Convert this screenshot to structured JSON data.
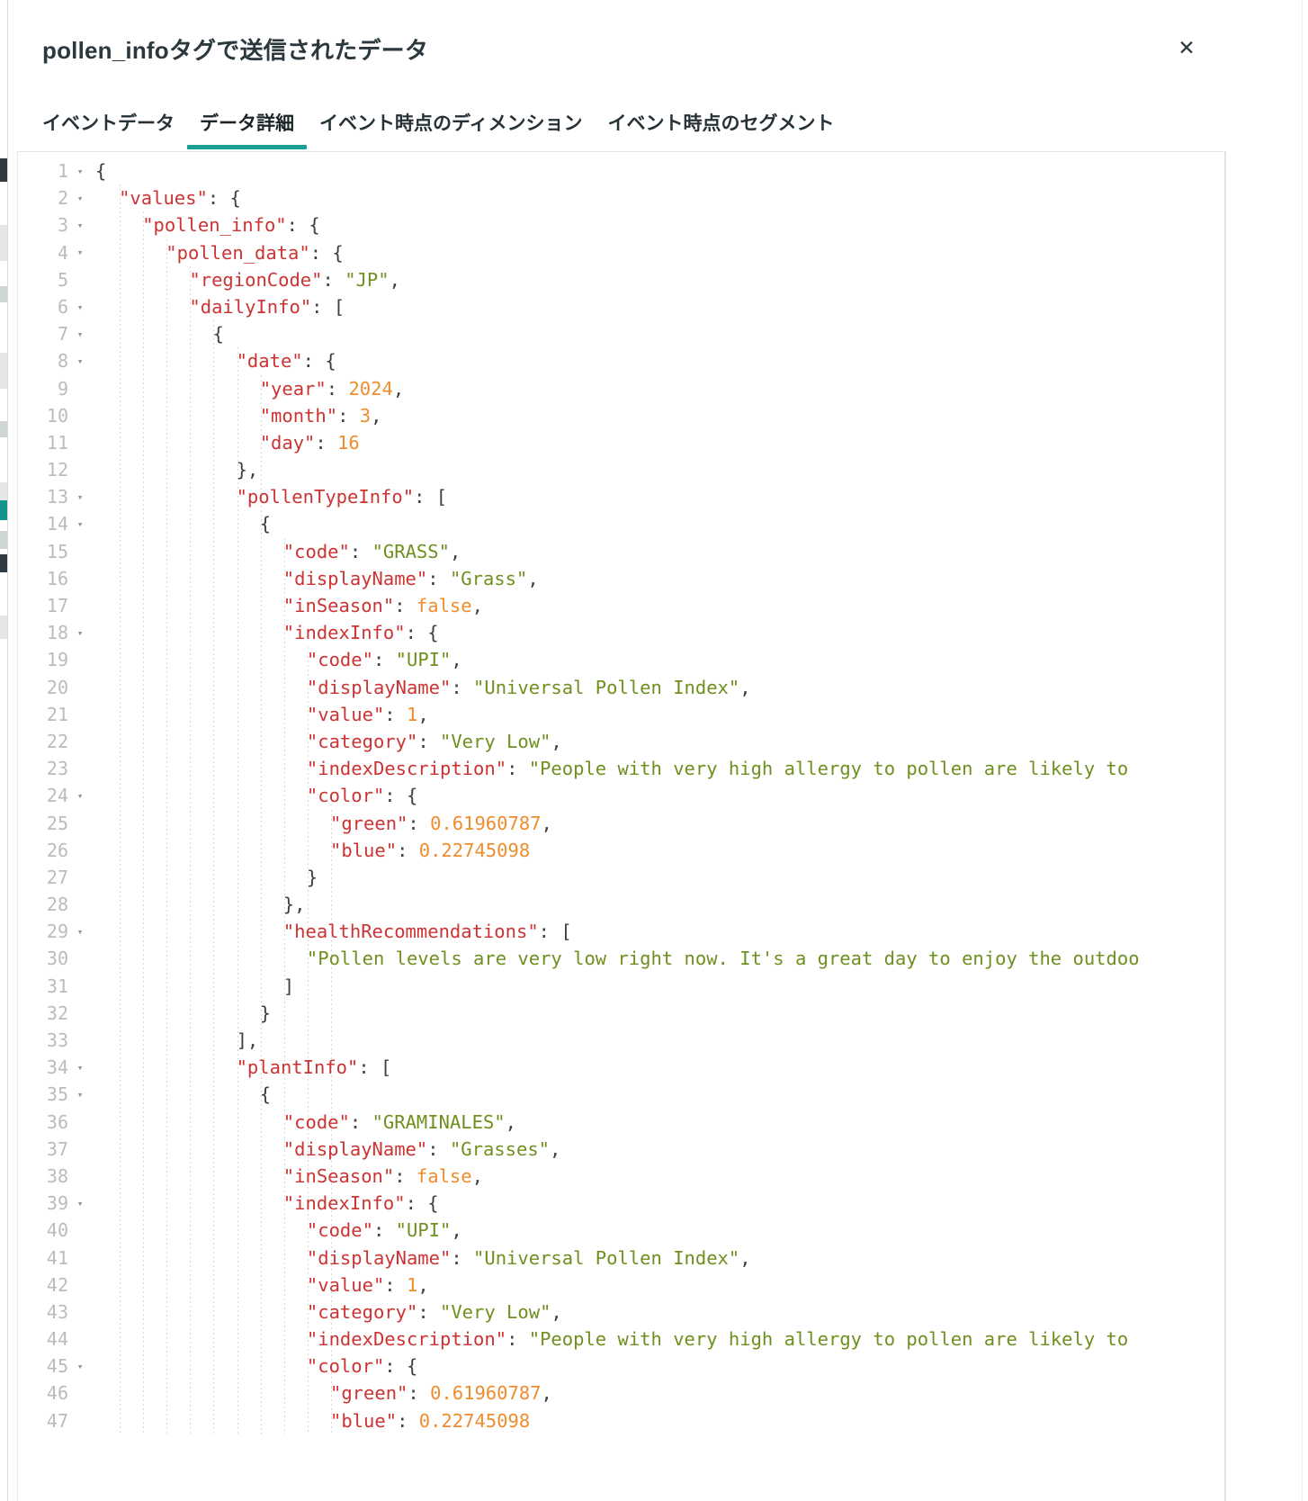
{
  "window": {
    "title": "pollen_infoタグで送信されたデータ",
    "close_label": "✕",
    "accent_color": "#1a9e96"
  },
  "tabs": [
    {
      "label": "イベントデータ",
      "active": false
    },
    {
      "label": "データ詳細",
      "active": true
    },
    {
      "label": "イベント時点のディメンション",
      "active": false
    },
    {
      "label": "イベント時点のセグメント",
      "active": false
    }
  ],
  "editor": {
    "syntax_colors": {
      "key": "#cc3333",
      "string": "#6f8f1e",
      "number": "#ef8c2e",
      "punctuation": "#3b4043",
      "line_number": "#b9bcbe"
    },
    "lines": [
      {
        "n": "1",
        "fold": "▾",
        "indent": 0,
        "tokens": [
          {
            "t": "p",
            "v": "{"
          }
        ]
      },
      {
        "n": "2",
        "fold": "▾",
        "indent": 1,
        "tokens": [
          {
            "t": "k",
            "v": "\"values\""
          },
          {
            "t": "p",
            "v": ": {"
          }
        ]
      },
      {
        "n": "3",
        "fold": "▾",
        "indent": 2,
        "tokens": [
          {
            "t": "k",
            "v": "\"pollen_info\""
          },
          {
            "t": "p",
            "v": ": {"
          }
        ]
      },
      {
        "n": "4",
        "fold": "▾",
        "indent": 3,
        "tokens": [
          {
            "t": "k",
            "v": "\"pollen_data\""
          },
          {
            "t": "p",
            "v": ": {"
          }
        ]
      },
      {
        "n": "5",
        "fold": "",
        "indent": 4,
        "tokens": [
          {
            "t": "k",
            "v": "\"regionCode\""
          },
          {
            "t": "p",
            "v": ": "
          },
          {
            "t": "s",
            "v": "\"JP\""
          },
          {
            "t": "p",
            "v": ","
          }
        ]
      },
      {
        "n": "6",
        "fold": "▾",
        "indent": 4,
        "tokens": [
          {
            "t": "k",
            "v": "\"dailyInfo\""
          },
          {
            "t": "p",
            "v": ": ["
          }
        ]
      },
      {
        "n": "7",
        "fold": "▾",
        "indent": 5,
        "tokens": [
          {
            "t": "p",
            "v": "{"
          }
        ]
      },
      {
        "n": "8",
        "fold": "▾",
        "indent": 6,
        "tokens": [
          {
            "t": "k",
            "v": "\"date\""
          },
          {
            "t": "p",
            "v": ": {"
          }
        ]
      },
      {
        "n": "9",
        "fold": "",
        "indent": 7,
        "tokens": [
          {
            "t": "k",
            "v": "\"year\""
          },
          {
            "t": "p",
            "v": ": "
          },
          {
            "t": "n",
            "v": "2024"
          },
          {
            "t": "p",
            "v": ","
          }
        ]
      },
      {
        "n": "10",
        "fold": "",
        "indent": 7,
        "tokens": [
          {
            "t": "k",
            "v": "\"month\""
          },
          {
            "t": "p",
            "v": ": "
          },
          {
            "t": "n",
            "v": "3"
          },
          {
            "t": "p",
            "v": ","
          }
        ]
      },
      {
        "n": "11",
        "fold": "",
        "indent": 7,
        "tokens": [
          {
            "t": "k",
            "v": "\"day\""
          },
          {
            "t": "p",
            "v": ": "
          },
          {
            "t": "n",
            "v": "16"
          }
        ]
      },
      {
        "n": "12",
        "fold": "",
        "indent": 6,
        "tokens": [
          {
            "t": "p",
            "v": "},"
          }
        ]
      },
      {
        "n": "13",
        "fold": "▾",
        "indent": 6,
        "tokens": [
          {
            "t": "k",
            "v": "\"pollenTypeInfo\""
          },
          {
            "t": "p",
            "v": ": ["
          }
        ]
      },
      {
        "n": "14",
        "fold": "▾",
        "indent": 7,
        "tokens": [
          {
            "t": "p",
            "v": "{"
          }
        ]
      },
      {
        "n": "15",
        "fold": "",
        "indent": 8,
        "tokens": [
          {
            "t": "k",
            "v": "\"code\""
          },
          {
            "t": "p",
            "v": ": "
          },
          {
            "t": "s",
            "v": "\"GRASS\""
          },
          {
            "t": "p",
            "v": ","
          }
        ]
      },
      {
        "n": "16",
        "fold": "",
        "indent": 8,
        "tokens": [
          {
            "t": "k",
            "v": "\"displayName\""
          },
          {
            "t": "p",
            "v": ": "
          },
          {
            "t": "s",
            "v": "\"Grass\""
          },
          {
            "t": "p",
            "v": ","
          }
        ]
      },
      {
        "n": "17",
        "fold": "",
        "indent": 8,
        "tokens": [
          {
            "t": "k",
            "v": "\"inSeason\""
          },
          {
            "t": "p",
            "v": ": "
          },
          {
            "t": "n",
            "v": "false"
          },
          {
            "t": "p",
            "v": ","
          }
        ]
      },
      {
        "n": "18",
        "fold": "▾",
        "indent": 8,
        "tokens": [
          {
            "t": "k",
            "v": "\"indexInfo\""
          },
          {
            "t": "p",
            "v": ": {"
          }
        ]
      },
      {
        "n": "19",
        "fold": "",
        "indent": 9,
        "tokens": [
          {
            "t": "k",
            "v": "\"code\""
          },
          {
            "t": "p",
            "v": ": "
          },
          {
            "t": "s",
            "v": "\"UPI\""
          },
          {
            "t": "p",
            "v": ","
          }
        ]
      },
      {
        "n": "20",
        "fold": "",
        "indent": 9,
        "tokens": [
          {
            "t": "k",
            "v": "\"displayName\""
          },
          {
            "t": "p",
            "v": ": "
          },
          {
            "t": "s",
            "v": "\"Universal Pollen Index\""
          },
          {
            "t": "p",
            "v": ","
          }
        ]
      },
      {
        "n": "21",
        "fold": "",
        "indent": 9,
        "tokens": [
          {
            "t": "k",
            "v": "\"value\""
          },
          {
            "t": "p",
            "v": ": "
          },
          {
            "t": "n",
            "v": "1"
          },
          {
            "t": "p",
            "v": ","
          }
        ]
      },
      {
        "n": "22",
        "fold": "",
        "indent": 9,
        "tokens": [
          {
            "t": "k",
            "v": "\"category\""
          },
          {
            "t": "p",
            "v": ": "
          },
          {
            "t": "s",
            "v": "\"Very Low\""
          },
          {
            "t": "p",
            "v": ","
          }
        ]
      },
      {
        "n": "23",
        "fold": "",
        "indent": 9,
        "tokens": [
          {
            "t": "k",
            "v": "\"indexDescription\""
          },
          {
            "t": "p",
            "v": ": "
          },
          {
            "t": "s",
            "v": "\"People with very high allergy to pollen are likely to"
          }
        ]
      },
      {
        "n": "24",
        "fold": "▾",
        "indent": 9,
        "tokens": [
          {
            "t": "k",
            "v": "\"color\""
          },
          {
            "t": "p",
            "v": ": {"
          }
        ]
      },
      {
        "n": "25",
        "fold": "",
        "indent": 10,
        "tokens": [
          {
            "t": "k",
            "v": "\"green\""
          },
          {
            "t": "p",
            "v": ": "
          },
          {
            "t": "n",
            "v": "0.61960787"
          },
          {
            "t": "p",
            "v": ","
          }
        ]
      },
      {
        "n": "26",
        "fold": "",
        "indent": 10,
        "tokens": [
          {
            "t": "k",
            "v": "\"blue\""
          },
          {
            "t": "p",
            "v": ": "
          },
          {
            "t": "n",
            "v": "0.22745098"
          }
        ]
      },
      {
        "n": "27",
        "fold": "",
        "indent": 9,
        "tokens": [
          {
            "t": "p",
            "v": "}"
          }
        ]
      },
      {
        "n": "28",
        "fold": "",
        "indent": 8,
        "tokens": [
          {
            "t": "p",
            "v": "},"
          }
        ]
      },
      {
        "n": "29",
        "fold": "▾",
        "indent": 8,
        "tokens": [
          {
            "t": "k",
            "v": "\"healthRecommendations\""
          },
          {
            "t": "p",
            "v": ": ["
          }
        ]
      },
      {
        "n": "30",
        "fold": "",
        "indent": 9,
        "tokens": [
          {
            "t": "s",
            "v": "\"Pollen levels are very low right now. It's a great day to enjoy the outdoo"
          }
        ]
      },
      {
        "n": "31",
        "fold": "",
        "indent": 8,
        "tokens": [
          {
            "t": "p",
            "v": "]"
          }
        ]
      },
      {
        "n": "32",
        "fold": "",
        "indent": 7,
        "tokens": [
          {
            "t": "p",
            "v": "}"
          }
        ]
      },
      {
        "n": "33",
        "fold": "",
        "indent": 6,
        "tokens": [
          {
            "t": "p",
            "v": "],"
          }
        ]
      },
      {
        "n": "34",
        "fold": "▾",
        "indent": 6,
        "tokens": [
          {
            "t": "k",
            "v": "\"plantInfo\""
          },
          {
            "t": "p",
            "v": ": ["
          }
        ]
      },
      {
        "n": "35",
        "fold": "▾",
        "indent": 7,
        "tokens": [
          {
            "t": "p",
            "v": "{"
          }
        ]
      },
      {
        "n": "36",
        "fold": "",
        "indent": 8,
        "tokens": [
          {
            "t": "k",
            "v": "\"code\""
          },
          {
            "t": "p",
            "v": ": "
          },
          {
            "t": "s",
            "v": "\"GRAMINALES\""
          },
          {
            "t": "p",
            "v": ","
          }
        ]
      },
      {
        "n": "37",
        "fold": "",
        "indent": 8,
        "tokens": [
          {
            "t": "k",
            "v": "\"displayName\""
          },
          {
            "t": "p",
            "v": ": "
          },
          {
            "t": "s",
            "v": "\"Grasses\""
          },
          {
            "t": "p",
            "v": ","
          }
        ]
      },
      {
        "n": "38",
        "fold": "",
        "indent": 8,
        "tokens": [
          {
            "t": "k",
            "v": "\"inSeason\""
          },
          {
            "t": "p",
            "v": ": "
          },
          {
            "t": "n",
            "v": "false"
          },
          {
            "t": "p",
            "v": ","
          }
        ]
      },
      {
        "n": "39",
        "fold": "▾",
        "indent": 8,
        "tokens": [
          {
            "t": "k",
            "v": "\"indexInfo\""
          },
          {
            "t": "p",
            "v": ": {"
          }
        ]
      },
      {
        "n": "40",
        "fold": "",
        "indent": 9,
        "tokens": [
          {
            "t": "k",
            "v": "\"code\""
          },
          {
            "t": "p",
            "v": ": "
          },
          {
            "t": "s",
            "v": "\"UPI\""
          },
          {
            "t": "p",
            "v": ","
          }
        ]
      },
      {
        "n": "41",
        "fold": "",
        "indent": 9,
        "tokens": [
          {
            "t": "k",
            "v": "\"displayName\""
          },
          {
            "t": "p",
            "v": ": "
          },
          {
            "t": "s",
            "v": "\"Universal Pollen Index\""
          },
          {
            "t": "p",
            "v": ","
          }
        ]
      },
      {
        "n": "42",
        "fold": "",
        "indent": 9,
        "tokens": [
          {
            "t": "k",
            "v": "\"value\""
          },
          {
            "t": "p",
            "v": ": "
          },
          {
            "t": "n",
            "v": "1"
          },
          {
            "t": "p",
            "v": ","
          }
        ]
      },
      {
        "n": "43",
        "fold": "",
        "indent": 9,
        "tokens": [
          {
            "t": "k",
            "v": "\"category\""
          },
          {
            "t": "p",
            "v": ": "
          },
          {
            "t": "s",
            "v": "\"Very Low\""
          },
          {
            "t": "p",
            "v": ","
          }
        ]
      },
      {
        "n": "44",
        "fold": "",
        "indent": 9,
        "tokens": [
          {
            "t": "k",
            "v": "\"indexDescription\""
          },
          {
            "t": "p",
            "v": ": "
          },
          {
            "t": "s",
            "v": "\"People with very high allergy to pollen are likely to"
          }
        ]
      },
      {
        "n": "45",
        "fold": "▾",
        "indent": 9,
        "tokens": [
          {
            "t": "k",
            "v": "\"color\""
          },
          {
            "t": "p",
            "v": ": {"
          }
        ]
      },
      {
        "n": "46",
        "fold": "",
        "indent": 10,
        "tokens": [
          {
            "t": "k",
            "v": "\"green\""
          },
          {
            "t": "p",
            "v": ": "
          },
          {
            "t": "n",
            "v": "0.61960787"
          },
          {
            "t": "p",
            "v": ","
          }
        ]
      },
      {
        "n": "47",
        "fold": "",
        "indent": 10,
        "tokens": [
          {
            "t": "k",
            "v": "\"blue\""
          },
          {
            "t": "p",
            "v": ": "
          },
          {
            "t": "n",
            "v": "0.22745098"
          }
        ]
      }
    ]
  }
}
